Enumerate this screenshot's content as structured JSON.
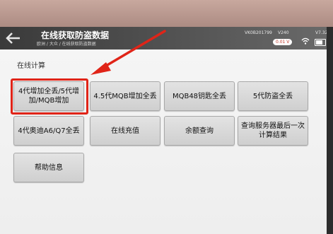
{
  "header": {
    "title": "在线获取防盗数据",
    "breadcrumb": "欧洲 / 大众 / 在线获取防盗数据",
    "vin": "VK0B201799",
    "version": "V240",
    "version_extra": "V7.32",
    "voltage": "0.01 V"
  },
  "section": {
    "title": "在线计算"
  },
  "buttons": [
    {
      "label": "4代增加全丢/5代增加/MQB增加"
    },
    {
      "label": "4.5代MQB增加全丢"
    },
    {
      "label": "MQB48钥匙全丢"
    },
    {
      "label": "5代防盗全丢"
    },
    {
      "label": "4代奥迪A6/Q7全丢"
    },
    {
      "label": "在线充值"
    },
    {
      "label": "余额查询"
    },
    {
      "label": "查询服务器最后一次计算结果"
    },
    {
      "label": "帮助信息"
    }
  ],
  "colors": {
    "highlight": "#e02418",
    "header": "#454545",
    "screen": "#f2f2f2"
  },
  "icons": [
    "back-icon",
    "wifi-icon",
    "battery-icon",
    "arrow-annotation"
  ]
}
